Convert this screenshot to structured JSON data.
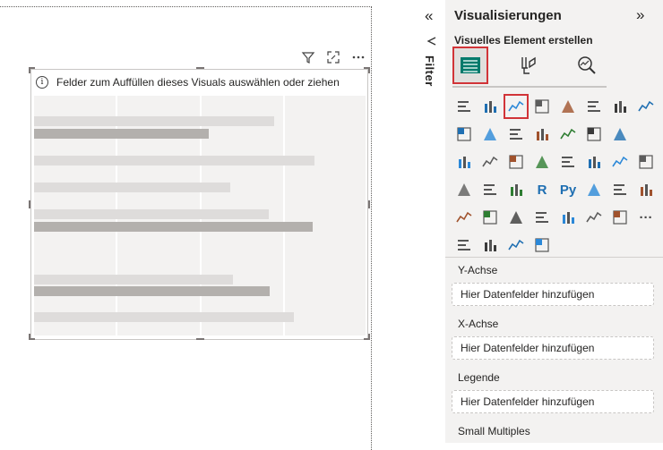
{
  "canvas": {
    "visual": {
      "header_icons": [
        "filter-icon",
        "focus-mode-icon",
        "more-options-icon"
      ],
      "info_text": "Felder zum Auffüllen dieses Visuals auswählen oder ziehen"
    }
  },
  "filter_pane": {
    "collapse_glyph": "«",
    "label": "Filter"
  },
  "visualizations_pane": {
    "title": "Visualisierungen",
    "expand_glyph": "»",
    "subtitle": "Visuelles Element erstellen",
    "modes": [
      "build-visual-icon",
      "format-visual-icon",
      "analytics-icon"
    ],
    "selected_mode": 0,
    "visual_types_rows": [
      [
        "stacked-bar-chart",
        "stacked-column-chart",
        "clustered-bar-chart",
        "clustered-column-chart",
        "100-stacked-bar-chart",
        "100-stacked-column-chart",
        "line-chart",
        "area-chart"
      ],
      [
        "stacked-area-chart",
        "line-and-stacked-column",
        "line-and-clustered-column",
        "ribbon-chart",
        "waterfall-chart",
        "funnel",
        "scatter-chart"
      ],
      [
        "pie-chart",
        "donut-chart",
        "treemap",
        "map",
        "azure-map",
        "gauge",
        "card",
        "kpi"
      ],
      [
        "slicer",
        "table",
        "matrix",
        "r-visual",
        "python-visual",
        "key-influencers",
        "decomposition-tree",
        "qa"
      ],
      [
        "paginated-report",
        "smart-narrative",
        "power-automate",
        "image",
        "arcgis-map",
        "power-apps",
        "shape-map",
        "more"
      ],
      [
        "globe-map",
        "filled-map",
        "trophy",
        "power-automate-2"
      ]
    ],
    "glyphs": {
      "r-visual": "R",
      "python-visual": "Py",
      "more": "···"
    },
    "wells": [
      {
        "label": "Y-Achse",
        "placeholder": "Hier Datenfelder hinzufügen"
      },
      {
        "label": "X-Achse",
        "placeholder": "Hier Datenfelder hinzufügen"
      },
      {
        "label": "Legende",
        "placeholder": "Hier Datenfelder hinzufügen"
      },
      {
        "label": "Small Multiples"
      }
    ]
  },
  "colors": {
    "selection_red": "#d13438",
    "pane_bg": "#f3f2f1",
    "accent_teal": "#00796b"
  }
}
